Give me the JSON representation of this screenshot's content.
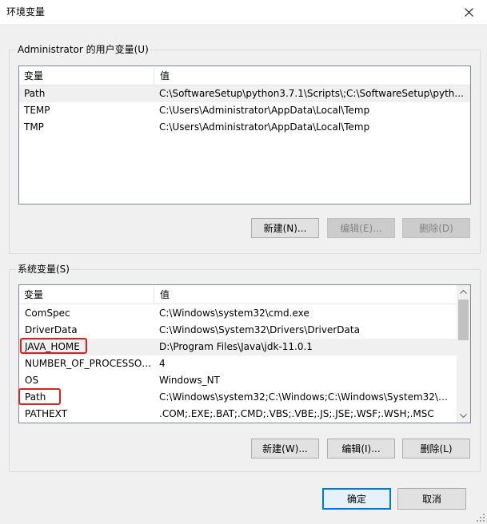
{
  "window": {
    "title": "环境变量"
  },
  "user_vars": {
    "group_label": "Administrator 的用户变量(U)",
    "columns": [
      "变量",
      "值"
    ],
    "rows": [
      {
        "name": "Path",
        "value": "C:\\SoftwareSetup\\python3.7.1\\Scripts\\;C:\\SoftwareSetup\\pyth..."
      },
      {
        "name": "TEMP",
        "value": "C:\\Users\\Administrator\\AppData\\Local\\Temp"
      },
      {
        "name": "TMP",
        "value": "C:\\Users\\Administrator\\AppData\\Local\\Temp"
      }
    ],
    "buttons": {
      "new": "新建(N)...",
      "edit": "编辑(E)...",
      "delete": "删除(D)"
    }
  },
  "system_vars": {
    "group_label": "系统变量(S)",
    "columns": [
      "变量",
      "值"
    ],
    "rows": [
      {
        "name": "ComSpec",
        "value": "C:\\Windows\\system32\\cmd.exe"
      },
      {
        "name": "DriverData",
        "value": "C:\\Windows\\System32\\Drivers\\DriverData"
      },
      {
        "name": "JAVA_HOME",
        "value": "D:\\Program Files\\Java\\jdk-11.0.1"
      },
      {
        "name": "NUMBER_OF_PROCESSORS",
        "value": "4"
      },
      {
        "name": "OS",
        "value": "Windows_NT"
      },
      {
        "name": "Path",
        "value": "C:\\Windows\\system32;C:\\Windows;C:\\Windows\\System32\\Wb..."
      },
      {
        "name": "PATHEXT",
        "value": ".COM;.EXE;.BAT;.CMD;.VBS;.VBE;.JS;.JSE;.WSF;.WSH;.MSC"
      }
    ],
    "buttons": {
      "new": "新建(W)...",
      "edit": "编辑(I)...",
      "delete": "删除(L)"
    }
  },
  "footer": {
    "ok": "确定",
    "cancel": "取消"
  },
  "icons": {
    "close": "close-icon",
    "scroll_up": "chevron-up-icon",
    "scroll_down": "chevron-down-icon",
    "grip": "resize-grip-icon"
  },
  "colors": {
    "highlight": "#e02020",
    "default_button_border": "#0078d7"
  }
}
